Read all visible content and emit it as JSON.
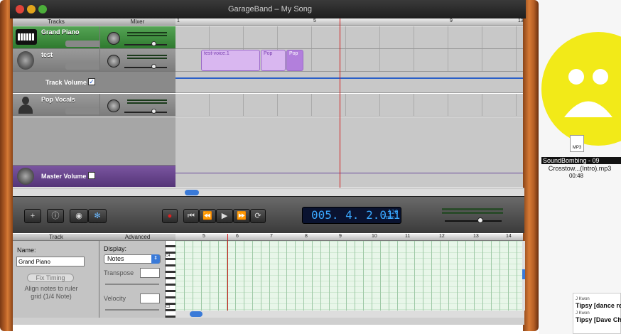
{
  "window": {
    "title": "GarageBand – My Song"
  },
  "headers": {
    "tracks": "Tracks",
    "mixer": "Mixer"
  },
  "tracks": [
    {
      "name": "Grand Piano",
      "selected": true
    },
    {
      "name": "test",
      "selected": false
    },
    {
      "name": "Pop Vocals",
      "selected": false
    }
  ],
  "track_volume": {
    "label": "Track Volume",
    "checked": true
  },
  "master": {
    "label": "Master Volume"
  },
  "regions": [
    {
      "label": "test-voice.1"
    },
    {
      "label": "Pop"
    },
    {
      "label": "Pop"
    }
  ],
  "ruler": [
    "1",
    "5",
    "9",
    "13"
  ],
  "lcd": {
    "position": "005. 4. 2.011",
    "tempo": "120",
    "tempo_label": "TEMPO"
  },
  "editor": {
    "track_header": "Track",
    "advanced_header": "Advanced",
    "name_label": "Name:",
    "name_value": "Grand Piano",
    "fix_timing": "Fix Timing",
    "align_note": "Align notes to ruler grid (1/4 Note)",
    "display_label": "Display:",
    "display_value": "Notes",
    "transpose_label": "Transpose",
    "velocity_label": "Velocity",
    "ruler": [
      "5",
      "6",
      "7",
      "8",
      "9",
      "10",
      "11",
      "12",
      "13",
      "14"
    ],
    "key_labels": [
      "C4",
      "C3"
    ]
  },
  "desktop": {
    "file_name": "SoundBombing - 09",
    "file_name2": "Crosstow...(Intro).mp3",
    "duration": "00:48",
    "file_icon": "MP3",
    "item1_artist": "J Kwon",
    "item1_title": "Tipsy [dance re",
    "item2_artist": "J Kwon",
    "item2_title": "Tipsy [Dave Ch"
  },
  "colors": {
    "accent_green": "#3a8a3a",
    "region": "#d9b7f0",
    "lcd_text": "#3aa8ff",
    "playhead": "#d21a1a"
  }
}
